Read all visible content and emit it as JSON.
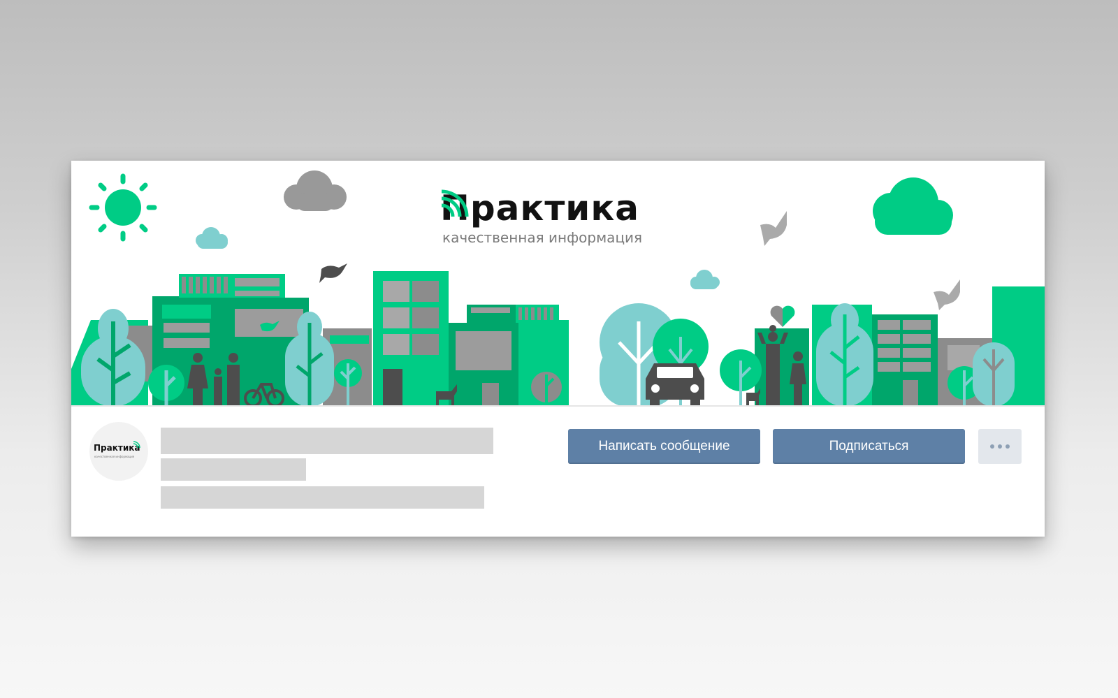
{
  "cover": {
    "brand_name": "Практика",
    "brand_tagline": "качественная информация",
    "colors": {
      "green": "#00cc85",
      "dark_green": "#00a66b",
      "light_teal": "#7fcfcf",
      "gray": "#8c8c8c",
      "dark_gray": "#4d4d4d",
      "cloud_gray": "#999999"
    }
  },
  "profile": {
    "avatar_name": "Практика",
    "avatar_tagline": "качественная информация",
    "buttons": {
      "message": "Написать сообщение",
      "subscribe": "Подписаться"
    },
    "button_color": "#5e80a6",
    "more_icon": "ellipsis-icon"
  }
}
